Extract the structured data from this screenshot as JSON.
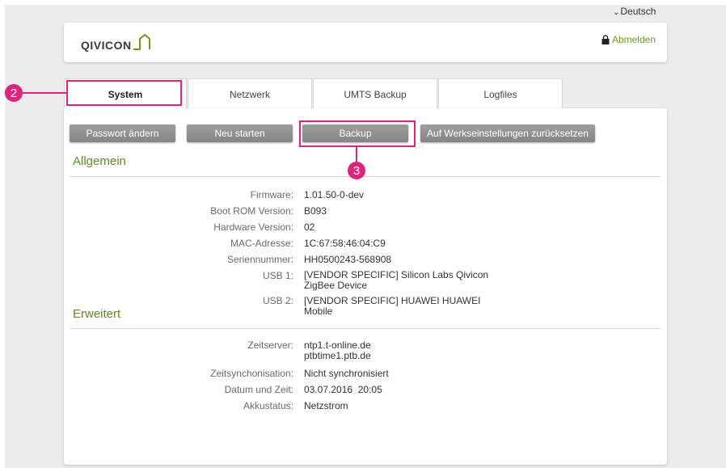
{
  "language": {
    "label": "Deutsch"
  },
  "header": {
    "logo_text": "QIVICON",
    "logout_label": "Abmelden"
  },
  "tabs": [
    {
      "label": "System",
      "active": true
    },
    {
      "label": "Netzwerk",
      "active": false
    },
    {
      "label": "UMTS Backup",
      "active": false
    },
    {
      "label": "Logfiles",
      "active": false
    }
  ],
  "buttons": {
    "password": "Passwort ändern",
    "restart": "Neu starten",
    "backup": "Backup",
    "factory_reset": "Auf Werkseinstellungen zurücksetzen"
  },
  "sections": {
    "general": "Allgemein",
    "advanced": "Erweitert"
  },
  "general": [
    {
      "label": "Firmware:",
      "value": "1.01.50-0-dev"
    },
    {
      "label": "Boot ROM Version:",
      "value": "B093"
    },
    {
      "label": "Hardware Version:",
      "value": "02"
    },
    {
      "label": "MAC-Adresse:",
      "value": "1C:67:58:46:04:C9"
    },
    {
      "label": "Seriennummer:",
      "value": "HH0500243-568908"
    },
    {
      "label": "USB 1:",
      "value": "[VENDOR SPECIFIC] Silicon Labs Qivicon",
      "value2": "ZigBee Device"
    },
    {
      "label": "USB 2:",
      "value": "[VENDOR SPECIFIC] HUAWEI HUAWEI",
      "value2": "Mobile"
    }
  ],
  "advanced": [
    {
      "label": "Zeitserver:",
      "value": "ntp1.t-online.de",
      "value2": "ptbtime1.ptb.de"
    },
    {
      "label": "Zeitsynchonisation:",
      "value": "Nicht synchronisiert"
    },
    {
      "label": "Datum und Zeit:",
      "value": "03.07.2016  20:05"
    },
    {
      "label": "Akkustatus:",
      "value": "Netzstrom"
    }
  ],
  "annotations": {
    "marker_2": "2",
    "marker_3": "3",
    "color": "#d9267a"
  },
  "colors": {
    "accent_green": "#5d8f1c",
    "button_gray": "#919191",
    "highlight": "#d9267a"
  }
}
